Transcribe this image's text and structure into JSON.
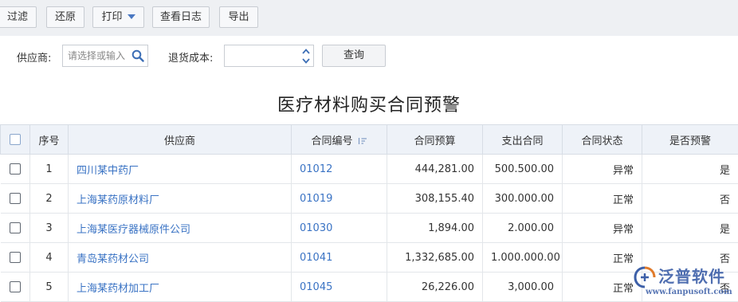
{
  "toolbar": {
    "filter_label": "过滤",
    "restore_label": "还原",
    "print_label": "打印",
    "view_log_label": "查看日志",
    "export_label": "导出"
  },
  "filters": {
    "supplier_label": "供应商:",
    "supplier_placeholder": "请选择或输入",
    "return_cost_label": "退货成本:",
    "return_cost_value": "",
    "query_label": "查询"
  },
  "report": {
    "title": "医疗材料购买合同预警"
  },
  "table": {
    "headers": {
      "index": "序号",
      "supplier": "供应商",
      "contract_no": "合同编号",
      "budget": "合同预算",
      "expense": "支出合同",
      "status": "合同状态",
      "warning": "是否预警"
    },
    "rows": [
      {
        "index": "1",
        "supplier": "四川某中药厂",
        "contract_no": "01012",
        "budget": "444,281.00",
        "expense": "500.500.00",
        "status": "异常",
        "warning": "是"
      },
      {
        "index": "2",
        "supplier": "上海某药原材料厂",
        "contract_no": "01019",
        "budget": "308,155.40",
        "expense": "300.000.00",
        "status": "正常",
        "warning": "否"
      },
      {
        "index": "3",
        "supplier": "上海某医疗器械原件公司",
        "contract_no": "01030",
        "budget": "1,894.00",
        "expense": "2.000.00",
        "status": "异常",
        "warning": "是"
      },
      {
        "index": "4",
        "supplier": "青岛某药材公司",
        "contract_no": "01041",
        "budget": "1,332,685.00",
        "expense": "1.000.000.00",
        "status": "正常",
        "warning": "否"
      },
      {
        "index": "5",
        "supplier": "上海某药材加工厂",
        "contract_no": "01045",
        "budget": "26,226.00",
        "expense": "3,000.00",
        "status": "正常",
        "warning": "否"
      }
    ]
  },
  "watermark": {
    "brand": "泛普软件",
    "url": "www.fanpusoft.com"
  },
  "colors": {
    "link": "#3a73c4",
    "header_bg": "#eef2f8",
    "toolbar_bg": "#eef0f3",
    "brand": "#3c5fa8"
  },
  "icons": {
    "print_dropdown": "chevron-down-icon",
    "supplier_search": "search-icon",
    "cost_spinner": "spinner-arrows-icon",
    "sort": "sort-icon",
    "watermark_logo": "fanpu-logo-icon"
  }
}
